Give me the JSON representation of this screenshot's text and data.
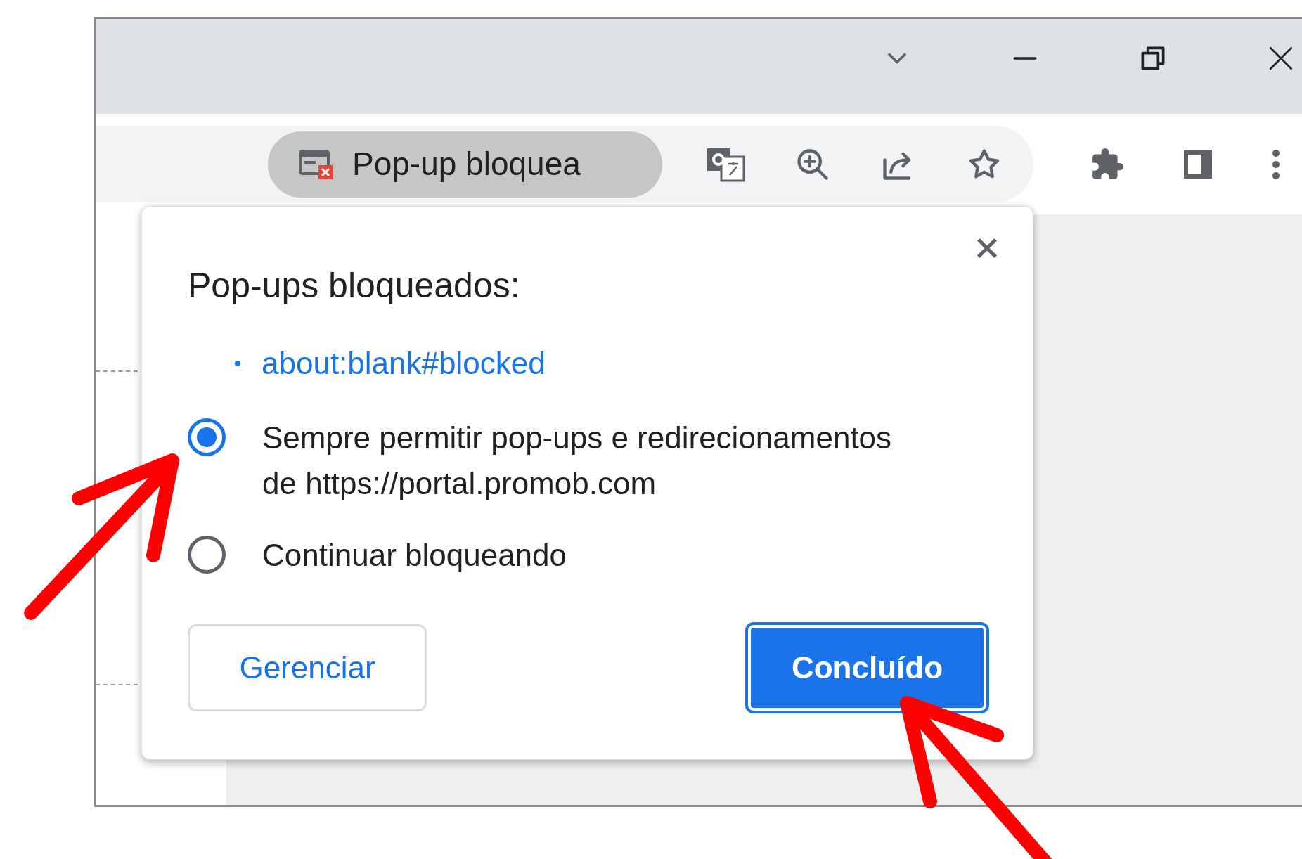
{
  "toolbar": {
    "blocked_indicator": "Pop-up bloquea"
  },
  "dialog": {
    "title": "Pop-ups bloqueados:",
    "blocked_links": [
      "about:blank#blocked"
    ],
    "options": [
      {
        "label": "Sempre permitir pop-ups e redirecionamentos de https://portal.promob.com",
        "selected": true
      },
      {
        "label": "Continuar bloqueando",
        "selected": false
      }
    ],
    "buttons": [
      {
        "label": "Gerenciar",
        "kind": "secondary"
      },
      {
        "label": "Concluído",
        "kind": "primary"
      }
    ]
  }
}
